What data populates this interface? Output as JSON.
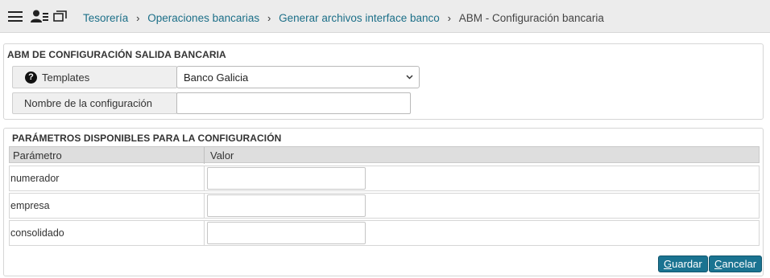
{
  "toolbar": {
    "icons": [
      "hamburger-menu-icon",
      "user-card-icon",
      "window-icon"
    ]
  },
  "breadcrumb": {
    "items": [
      "Tesorería",
      "Operaciones bancarias",
      "Generar archivos interface banco"
    ],
    "separator": "›",
    "current": "ABM - Configuración bancaria"
  },
  "config_section": {
    "title": "ABM DE CONFIGURACIÓN SALIDA BANCARIA",
    "templates_label": "Templates",
    "templates_value": "Banco Galicia",
    "name_label": "Nombre de la configuración",
    "name_value": ""
  },
  "params_section": {
    "title": "PARÁMETROS DISPONIBLES PARA LA CONFIGURACIÓN",
    "columns": [
      "Parámetro",
      "Valor"
    ],
    "rows": [
      {
        "param": "numerador",
        "value": ""
      },
      {
        "param": "empresa",
        "value": ""
      },
      {
        "param": "consolidado",
        "value": ""
      }
    ]
  },
  "actions": {
    "save_key": "G",
    "save_rest": "uardar",
    "cancel_key": "C",
    "cancel_rest": "ancelar"
  },
  "colors": {
    "accent": "#1a7391",
    "link": "#1c6f88",
    "topbar_bg": "#ececec"
  }
}
